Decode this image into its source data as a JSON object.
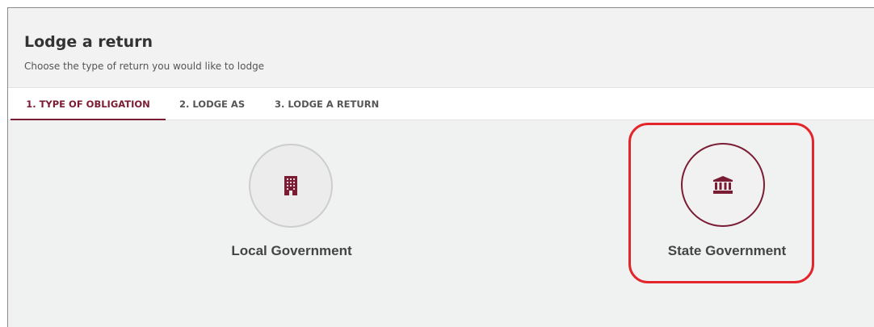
{
  "header": {
    "title": "Lodge a return",
    "subtitle": "Choose the type of return you would like to lodge"
  },
  "tabs": [
    {
      "label": "1. TYPE OF OBLIGATION",
      "active": true
    },
    {
      "label": "2. LODGE AS",
      "active": false
    },
    {
      "label": "3. LODGE A RETURN",
      "active": false
    }
  ],
  "options": [
    {
      "label": "Local Government",
      "icon": "building-icon",
      "selected": false
    },
    {
      "label": "State Government",
      "icon": "government-building-icon",
      "selected": true
    }
  ],
  "colors": {
    "accent": "#7a1c34",
    "highlight": "#e3262b",
    "background": "#f0f2f2"
  }
}
